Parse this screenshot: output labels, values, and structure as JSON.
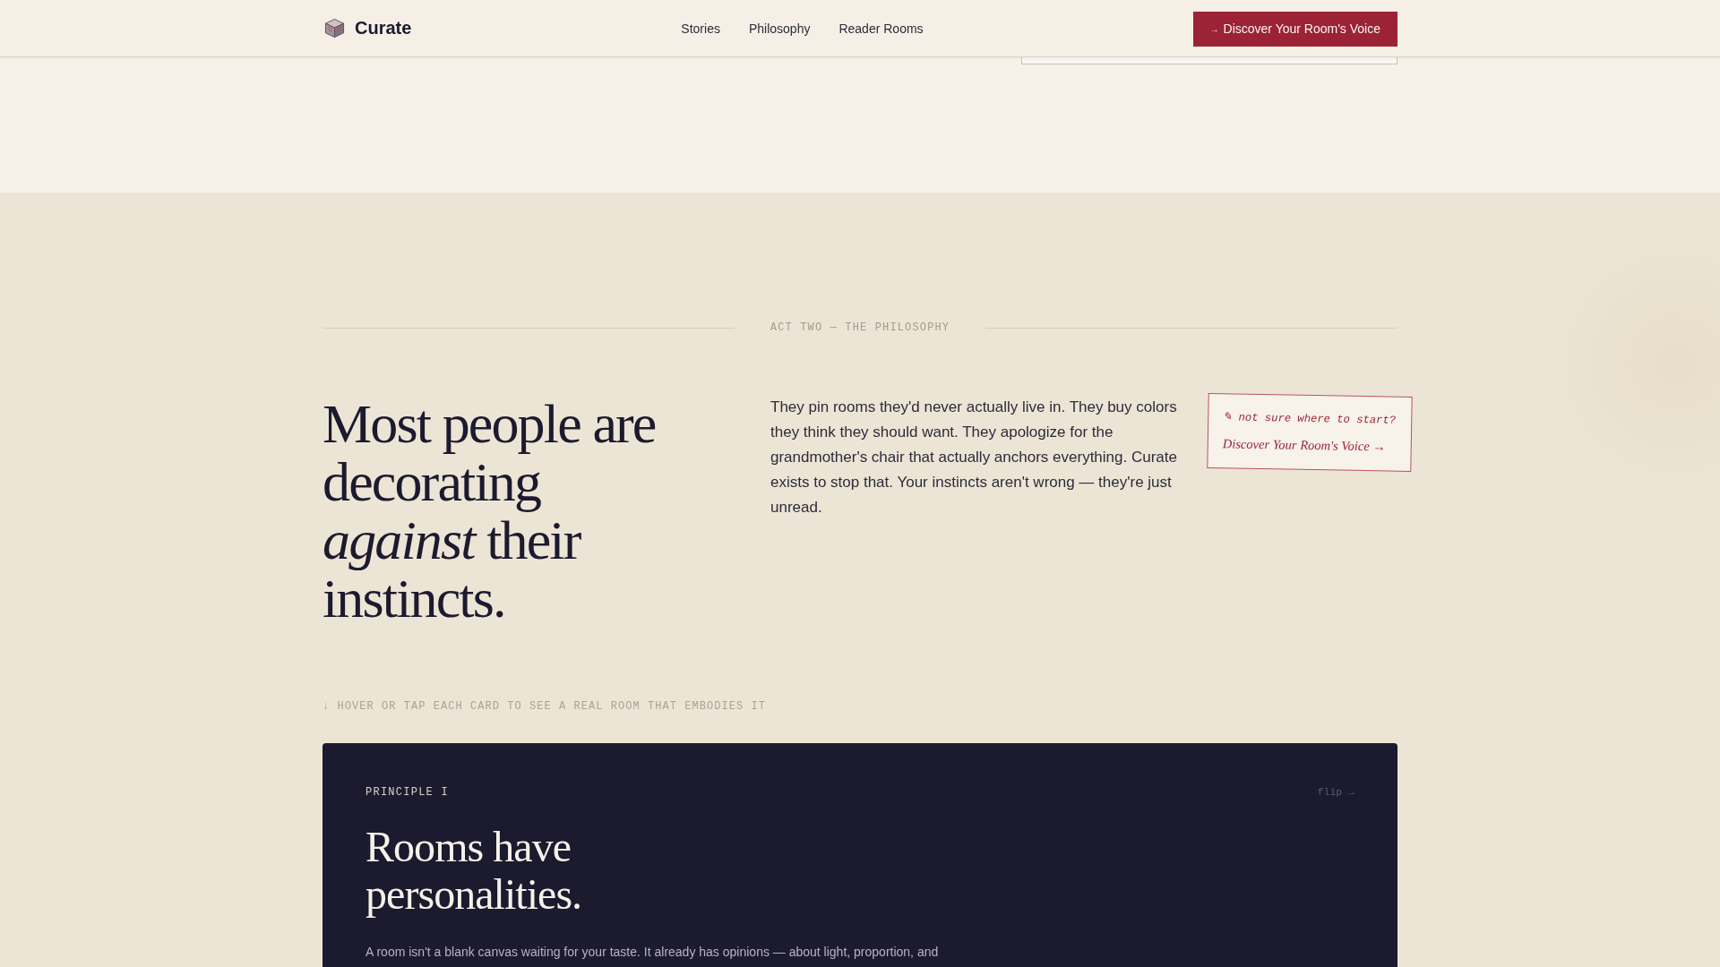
{
  "nav": {
    "brand": "Curate",
    "links": [
      {
        "label": "Stories"
      },
      {
        "label": "Philosophy"
      },
      {
        "label": "Reader Rooms"
      }
    ],
    "cta": {
      "arrow": "→",
      "label": "Discover Your Room's Voice"
    }
  },
  "philosophy": {
    "eyebrow": "ACT TWO — THE PHILOSOPHY",
    "heading": "Most people are decorating *against* their instincts.",
    "body": "They pin rooms they'd never actually live in. They buy colors they think they should want. They apologize for the grandmother's chair that actually anchors everything. Curate exists to stop that. Your instincts aren't wrong — they're just unread.",
    "note": {
      "hint": "✎ not sure where to start?",
      "link": "Discover Your Room's Voice →"
    },
    "hover_hint": "↓ HOVER OR TAP EACH CARD TO SEE A REAL ROOM THAT EMBODIES IT",
    "cards": [
      {
        "label": "PRINCIPLE I",
        "flip": "flip →",
        "title": "Rooms have personalities.",
        "body": "A room isn't a blank canvas waiting for your taste. It already has opinions — about light, proportion, and"
      }
    ]
  }
}
